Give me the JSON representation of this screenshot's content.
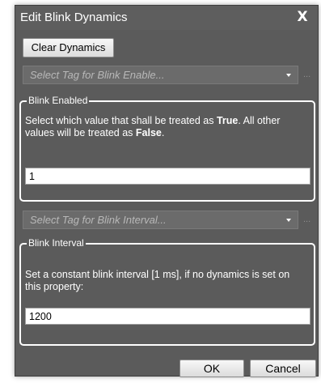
{
  "window": {
    "title": "Edit Blink Dynamics",
    "close_label": "X"
  },
  "toolbar": {
    "clear_label": "Clear Dynamics"
  },
  "blink_enable_tag": {
    "placeholder": "Select Tag for Blink Enable...",
    "extra": "..."
  },
  "blink_enabled": {
    "label": "Blink Enabled",
    "desc_part1": "Select which value that shall be treated as ",
    "desc_true": "True",
    "desc_part2": ". All other values will be treated as ",
    "desc_false": "False",
    "desc_part3": ".",
    "value": "1"
  },
  "blink_interval_tag": {
    "placeholder": "Select Tag for Blink Interval...",
    "extra": "..."
  },
  "blink_interval": {
    "label": "Blink Interval",
    "desc": "Set a constant blink interval [1 ms], if no dynamics is set on this property:",
    "value": "1200"
  },
  "footer": {
    "ok_label": "OK",
    "cancel_label": "Cancel"
  },
  "colors": {
    "window_bg": "#5b5b5b",
    "combo_bg": "#6b6b6b",
    "text": "#ffffff"
  }
}
